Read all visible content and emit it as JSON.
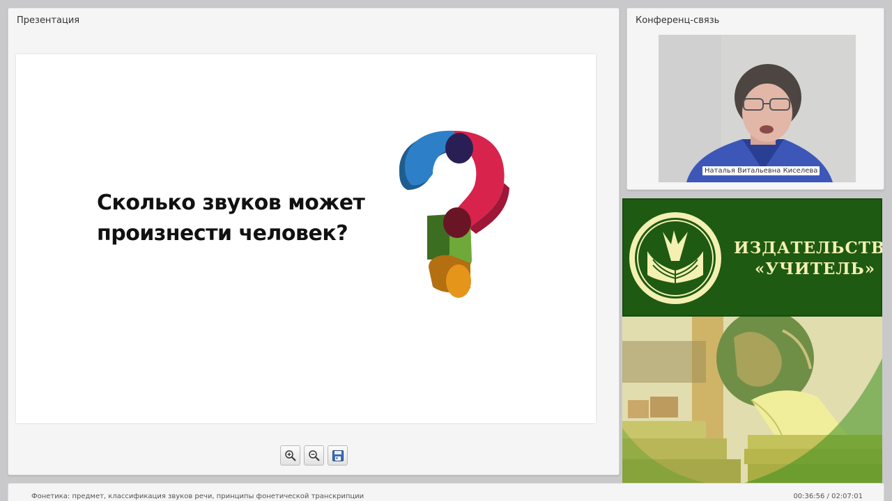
{
  "presentation": {
    "title": "Презентация",
    "slide": {
      "question_line1": "Сколько звуков может",
      "question_line2": "произнести человек?",
      "image_icon": "question-mark-3d-graphic"
    },
    "toolbar": {
      "zoom_in_icon": "zoom-in-icon",
      "zoom_out_icon": "zoom-out-icon",
      "save_icon": "save-icon"
    }
  },
  "conference": {
    "title": "Конференц-связь",
    "speaker_name": "Наталья Витальевна Киселева"
  },
  "ad": {
    "line1": "ИЗДАТЕЛЬСТВО",
    "line2": "«УЧИТЕЛЬ»",
    "colors": {
      "banner": "#1e5a12",
      "text": "#f4f0b2"
    }
  },
  "footer": {
    "course_title": "Фонетика: предмет, классификация звуков речи, принципы фонетической транскрипции",
    "time": "00:36:56 / 02:07:01"
  }
}
